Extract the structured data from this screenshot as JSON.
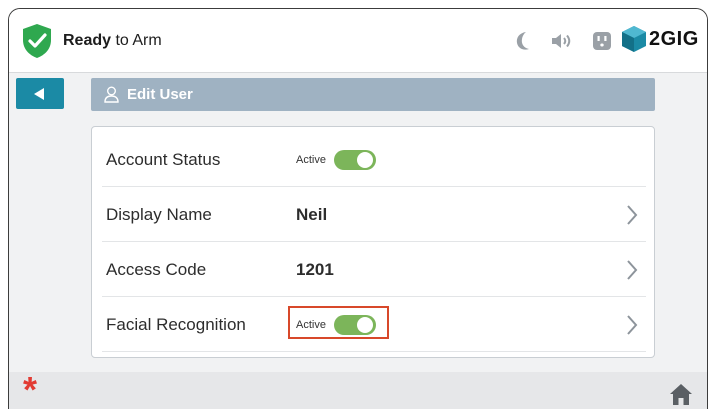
{
  "status": {
    "bold": "Ready",
    "rest": " to Arm",
    "shield_color": "#2fa84f"
  },
  "top_icons": [
    "moon-icon",
    "speaker-icon",
    "outlet-icon"
  ],
  "brand": {
    "name": "2GIG",
    "color": "#1b8aa5"
  },
  "header": {
    "title": "Edit User",
    "bar_color": "#9fb2c2"
  },
  "rows": [
    {
      "label": "Account Status",
      "toggle_label": "Active",
      "toggle_on": true
    },
    {
      "label": "Display Name",
      "value": "Neil"
    },
    {
      "label": "Access Code",
      "value": "1201"
    },
    {
      "label": "Facial Recognition",
      "toggle_label": "Active",
      "toggle_on": true,
      "highlighted": true
    }
  ],
  "bottom": {
    "asterisk": "*"
  },
  "colors": {
    "accent": "#1b8aa5",
    "toggle_on": "#7cb55a",
    "highlight": "#d8482a",
    "alert": "#e23b33"
  }
}
